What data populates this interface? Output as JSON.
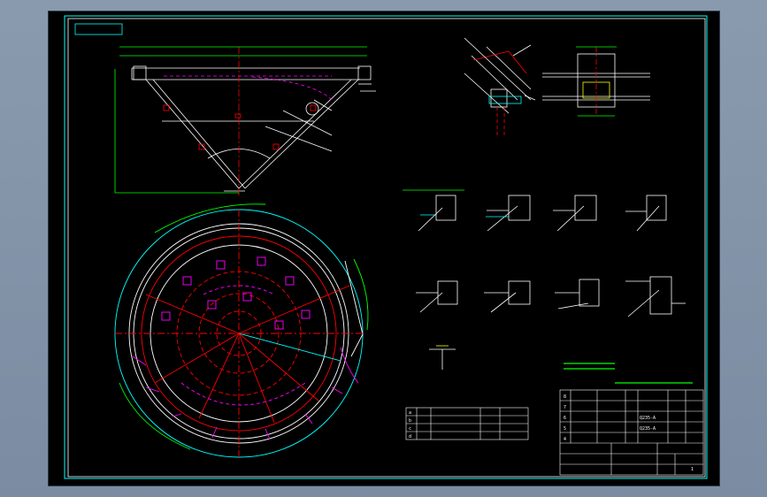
{
  "colors": {
    "background": "#000000",
    "frame": "#00ffff",
    "line": "#ffffff",
    "centerline": "#ff0000",
    "hidden": "#ff00ff",
    "hatch": "#ff0000",
    "dimension": "#00ff00",
    "text": "#ffffff",
    "accent": "#ffff00"
  },
  "drawing": {
    "title_block": {
      "rows": [
        [
          "8",
          "",
          "",
          "",
          "",
          ""
        ],
        [
          "7",
          "",
          "",
          "",
          "",
          ""
        ],
        [
          "6",
          "",
          "",
          "",
          "Q235-A",
          ""
        ],
        [
          "5",
          "",
          "",
          "",
          "Q235-A",
          ""
        ],
        [
          "4",
          "",
          "",
          "",
          "",
          ""
        ]
      ],
      "page": "1"
    },
    "schedule": {
      "rows": [
        [
          "a",
          "",
          "",
          "",
          ""
        ],
        [
          "b",
          "",
          "",
          "",
          ""
        ],
        [
          "c",
          "",
          "",
          "",
          ""
        ],
        [
          "d",
          "",
          "",
          "",
          ""
        ]
      ]
    }
  }
}
